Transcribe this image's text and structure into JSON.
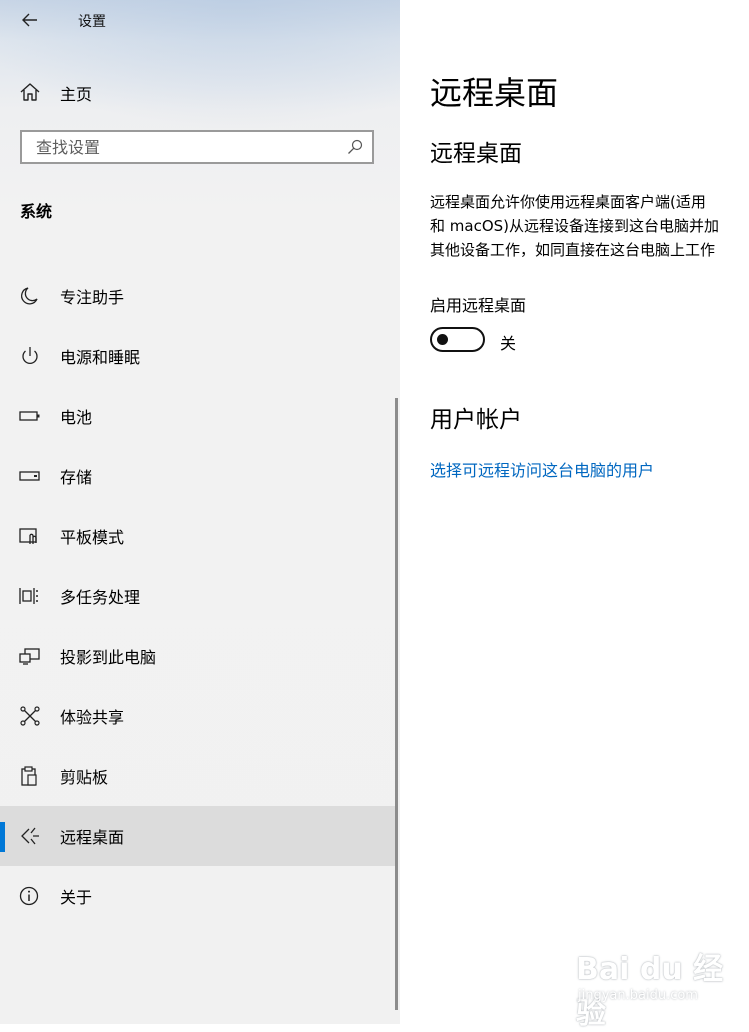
{
  "window": {
    "title": "设置"
  },
  "sidebar": {
    "home_label": "主页",
    "search_placeholder": "查找设置",
    "section_title": "系统",
    "items": [
      {
        "label": "专注助手",
        "icon": "moon-icon"
      },
      {
        "label": "电源和睡眠",
        "icon": "power-icon"
      },
      {
        "label": "电池",
        "icon": "battery-icon"
      },
      {
        "label": "存储",
        "icon": "storage-icon"
      },
      {
        "label": "平板模式",
        "icon": "tablet-mode-icon"
      },
      {
        "label": "多任务处理",
        "icon": "multitasking-icon"
      },
      {
        "label": "投影到此电脑",
        "icon": "project-icon"
      },
      {
        "label": "体验共享",
        "icon": "shared-experiences-icon"
      },
      {
        "label": "剪贴板",
        "icon": "clipboard-icon"
      },
      {
        "label": "远程桌面",
        "icon": "remote-desktop-icon",
        "selected": true
      },
      {
        "label": "关于",
        "icon": "info-icon"
      }
    ]
  },
  "main": {
    "page_title": "远程桌面",
    "section_title": "远程桌面",
    "description_lines": [
      "远程桌面允许你使用远程桌面客户端(适用",
      "和 macOS)从远程设备连接到这台电脑并加",
      "其他设备工作，如同直接在这台电脑上工作"
    ],
    "toggle_label": "启用远程桌面",
    "toggle_state": "关",
    "toggle_on": false,
    "user_section_title": "用户帐户",
    "user_link": "选择可远程访问这台电脑的用户"
  },
  "watermark": {
    "logo": "Bai du 经验",
    "url": "jingyan.baidu.com"
  },
  "colors": {
    "accent": "#0078d7",
    "link": "#0067c0",
    "selected_bg": "#dcdcdc"
  }
}
